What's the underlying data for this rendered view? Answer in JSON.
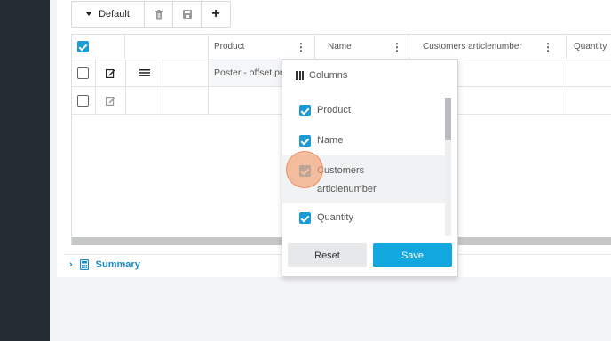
{
  "toolbar": {
    "default_label": "Default",
    "delete_icon": "trash-icon",
    "save_icon": "floppy-disk-icon",
    "add_label": "+"
  },
  "grid": {
    "columns": [
      "Product",
      "Name",
      "Customers articlenumber",
      "Quantity"
    ],
    "rows": [
      {
        "product": "Poster - offset pr"
      },
      {
        "product": ""
      }
    ]
  },
  "summary": {
    "label": "Summary"
  },
  "column_menu": {
    "title": "Columns",
    "items": [
      {
        "label": "Product",
        "checked": true
      },
      {
        "label": "Name",
        "checked": true
      },
      {
        "label": "Customers articlenumber",
        "checked": true
      },
      {
        "label": "Quantity",
        "checked": true
      }
    ],
    "reset_label": "Reset",
    "save_label": "Save"
  },
  "colors": {
    "accent": "#12a7de",
    "checkbox": "#1a9bd7",
    "sidebar": "#242c33"
  }
}
